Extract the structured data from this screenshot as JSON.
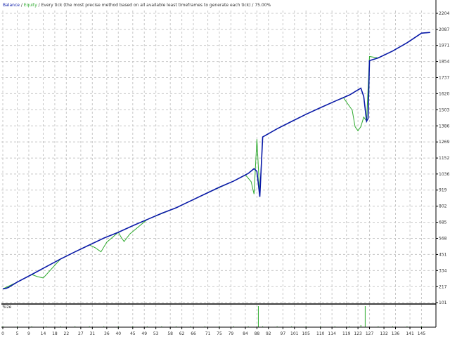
{
  "header": {
    "balance_label": "Balance",
    "sep1": " / ",
    "equity_label": "Equity",
    "description": " / Every tick (the most precise method based on all available least timeframes to generate each tick) / 75.00%"
  },
  "sub_panel_label": "Size",
  "colors": {
    "background": "#ffffff",
    "grid": "#c8c8c8",
    "balance": "#0a1aa8",
    "equity": "#2eaa2e",
    "size_bars": "#2eaa2e",
    "axis": "#000000",
    "text": "#333333"
  },
  "chart_data": {
    "type": "line",
    "title": "",
    "y_ticks": [
      "2204",
      "2087",
      "1971",
      "1854",
      "1737",
      "1620",
      "1503",
      "1386",
      "1269",
      "1152",
      "1036",
      "919",
      "802",
      "685",
      "568",
      "451",
      "334",
      "217",
      "101"
    ],
    "x_ticks": [
      "0",
      "5",
      "9",
      "14",
      "18",
      "22",
      "27",
      "31",
      "36",
      "40",
      "45",
      "49",
      "53",
      "58",
      "62",
      "66",
      "71",
      "75",
      "79",
      "84",
      "88",
      "92",
      "97",
      "101",
      "105",
      "110",
      "114",
      "119",
      "123",
      "127",
      "132",
      "136",
      "141",
      "145"
    ],
    "xlim": [
      0,
      150
    ],
    "ylim": [
      101,
      2204
    ],
    "series": [
      {
        "name": "Balance",
        "x": [
          0,
          1,
          2,
          5,
          10,
          15,
          20,
          25,
          30,
          35,
          40,
          45,
          50,
          55,
          60,
          65,
          70,
          75,
          80,
          85,
          87,
          88,
          89,
          90,
          95,
          100,
          105,
          110,
          115,
          120,
          124,
          125,
          126,
          126.5,
          127,
          130,
          135,
          140,
          145,
          148
        ],
        "y": [
          201,
          203,
          212,
          250,
          305,
          362,
          418,
          470,
          520,
          570,
          612,
          660,
          705,
          750,
          790,
          840,
          890,
          940,
          985,
          1040,
          1075,
          1055,
          870,
          1305,
          1365,
          1418,
          1470,
          1518,
          1565,
          1610,
          1660,
          1600,
          1420,
          1440,
          1860,
          1880,
          1930,
          1990,
          2060,
          2065
        ]
      },
      {
        "name": "Equity",
        "x": [
          0,
          5,
          10,
          12,
          14,
          20,
          25,
          30,
          32,
          34,
          36,
          40,
          41,
          42,
          44,
          50,
          60,
          70,
          80,
          84,
          86,
          87,
          88,
          89,
          90,
          95,
          100,
          105,
          110,
          115,
          118,
          121,
          122,
          123,
          124,
          125,
          126,
          127,
          130,
          135,
          140,
          145,
          148
        ],
        "y": [
          201,
          250,
          305,
          290,
          280,
          418,
          470,
          520,
          500,
          470,
          540,
          612,
          575,
          545,
          600,
          705,
          790,
          890,
          985,
          1030,
          980,
          890,
          1290,
          880,
          1305,
          1365,
          1418,
          1470,
          1518,
          1565,
          1590,
          1500,
          1380,
          1350,
          1380,
          1450,
          1420,
          1890,
          1880,
          1930,
          1990,
          2060,
          2065
        ]
      }
    ],
    "size_bars": {
      "x": [
        0,
        5,
        10,
        15,
        20,
        25,
        30,
        35,
        40,
        45,
        50,
        55,
        60,
        65,
        70,
        75,
        80,
        85,
        88.5,
        90,
        95,
        100,
        105,
        110,
        115,
        120,
        124,
        125.5,
        130,
        135,
        140,
        145
      ],
      "values": [
        0.04,
        0.04,
        0.04,
        0.04,
        0.04,
        0.04,
        0.04,
        0.04,
        0.04,
        0.04,
        0.04,
        0.04,
        0.04,
        0.04,
        0.04,
        0.04,
        0.04,
        0.04,
        1.0,
        0.04,
        0.04,
        0.04,
        0.04,
        0.04,
        0.04,
        0.04,
        0.1,
        1.0,
        0.04,
        0.04,
        0.04,
        0.04
      ]
    },
    "grid": true
  }
}
